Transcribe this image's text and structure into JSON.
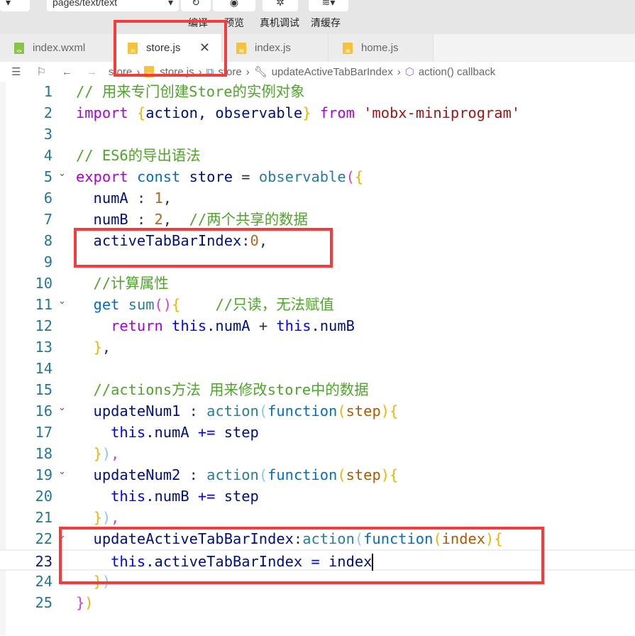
{
  "toolbar": {
    "page_select": "pages/text/text",
    "buttons": [
      {
        "label": "编译",
        "icon": "refresh-icon"
      },
      {
        "label": "预览",
        "icon": "eye-icon"
      },
      {
        "label": "真机调试",
        "icon": "bug-icon"
      },
      {
        "label": "清缓存",
        "icon": "layers-icon"
      }
    ]
  },
  "tabs": [
    {
      "label": "index.wxml",
      "type": "wxml"
    },
    {
      "label": "store.js",
      "type": "js",
      "active": true
    },
    {
      "label": "index.js",
      "type": "js"
    },
    {
      "label": "home.js",
      "type": "js"
    }
  ],
  "breadcrumb": [
    "store",
    "store.js",
    "store",
    "updateActiveTabBarIndex",
    "action() callback"
  ],
  "colors": {
    "highlight": "#f53b3b",
    "line_number": "#237893",
    "comment": "#4fa52a",
    "keyword": "#af00db"
  },
  "current_line": 23,
  "code": [
    {
      "n": "1",
      "t": [
        [
          "// 用来专门创建Store的实例对象",
          "c"
        ]
      ]
    },
    {
      "n": "2",
      "t": [
        [
          "import ",
          "k"
        ],
        [
          "{",
          "y"
        ],
        [
          "action, observable",
          "i"
        ],
        [
          "}",
          "y"
        ],
        [
          " from ",
          "k"
        ],
        [
          "'mobx-miniprogram'",
          "s"
        ]
      ]
    },
    {
      "n": "3",
      "t": []
    },
    {
      "n": "4",
      "t": [
        [
          "// ES6的导出语法",
          "c"
        ]
      ]
    },
    {
      "n": "5",
      "fold": true,
      "t": [
        [
          "export ",
          "k"
        ],
        [
          "const ",
          "fn"
        ],
        [
          "store",
          "i"
        ],
        [
          " = ",
          "p"
        ],
        [
          "observable",
          "f"
        ],
        [
          "(",
          "m"
        ],
        [
          "{",
          "y"
        ]
      ]
    },
    {
      "n": "6",
      "t": [
        [
          "  numA",
          "i"
        ],
        [
          " : ",
          "p"
        ],
        [
          "1",
          "n"
        ],
        [
          ",",
          "p"
        ]
      ]
    },
    {
      "n": "7",
      "t": [
        [
          "  numB",
          "i"
        ],
        [
          " : ",
          "p"
        ],
        [
          "2",
          "n"
        ],
        [
          ",  ",
          "p"
        ],
        [
          "//两个共享的数据",
          "c"
        ]
      ]
    },
    {
      "n": "8",
      "t": [
        [
          "  activeTabBarIndex",
          "i"
        ],
        [
          ":",
          "p"
        ],
        [
          "0",
          "n"
        ],
        [
          ",",
          "p"
        ]
      ]
    },
    {
      "n": "9",
      "t": []
    },
    {
      "n": "10",
      "t": [
        [
          "  //计算属性",
          "c"
        ]
      ]
    },
    {
      "n": "11",
      "fold": true,
      "t": [
        [
          "  get ",
          "fn"
        ],
        [
          "sum",
          "f"
        ],
        [
          "()",
          "m"
        ],
        [
          "{",
          "y"
        ],
        [
          "    //只读，无法赋值",
          "c"
        ]
      ]
    },
    {
      "n": "12",
      "t": [
        [
          "    return ",
          "k"
        ],
        [
          "this",
          "o"
        ],
        [
          ".numA",
          "i"
        ],
        [
          " + ",
          "p"
        ],
        [
          "this",
          "o"
        ],
        [
          ".numB",
          "i"
        ]
      ]
    },
    {
      "n": "13",
      "t": [
        [
          "  ",
          "p"
        ],
        [
          "}",
          "y"
        ],
        [
          ",",
          "p"
        ]
      ]
    },
    {
      "n": "14",
      "t": []
    },
    {
      "n": "15",
      "t": [
        [
          "  //actions方法 用来修改store中的数据",
          "c"
        ]
      ]
    },
    {
      "n": "16",
      "fold": true,
      "t": [
        [
          "  updateNum1",
          "i"
        ],
        [
          " : ",
          "p"
        ],
        [
          "action",
          "f"
        ],
        [
          "(",
          "lb"
        ],
        [
          "function",
          "fn"
        ],
        [
          "(",
          "y"
        ],
        [
          "step",
          "pm"
        ],
        [
          ")",
          "y"
        ],
        [
          "{",
          "y"
        ]
      ]
    },
    {
      "n": "17",
      "t": [
        [
          "    this",
          "o"
        ],
        [
          ".numA ",
          "i"
        ],
        [
          "+=",
          "o"
        ],
        [
          " step",
          "i"
        ]
      ]
    },
    {
      "n": "18",
      "t": [
        [
          "  ",
          "p"
        ],
        [
          "}",
          "y"
        ],
        [
          ")",
          "lb"
        ],
        [
          ",",
          "m"
        ]
      ]
    },
    {
      "n": "19",
      "fold": true,
      "t": [
        [
          "  updateNum2",
          "i"
        ],
        [
          " : ",
          "p"
        ],
        [
          "action",
          "f"
        ],
        [
          "(",
          "lb"
        ],
        [
          "function",
          "fn"
        ],
        [
          "(",
          "y"
        ],
        [
          "step",
          "pm"
        ],
        [
          ")",
          "y"
        ],
        [
          "{",
          "y"
        ]
      ]
    },
    {
      "n": "20",
      "t": [
        [
          "    this",
          "o"
        ],
        [
          ".numB ",
          "i"
        ],
        [
          "+=",
          "o"
        ],
        [
          " step",
          "i"
        ]
      ]
    },
    {
      "n": "21",
      "t": [
        [
          "  ",
          "p"
        ],
        [
          "}",
          "y"
        ],
        [
          ")",
          "lb"
        ],
        [
          ",",
          "m"
        ]
      ]
    },
    {
      "n": "22",
      "fold": true,
      "t": [
        [
          "  updateActiveTabBarIndex",
          "i"
        ],
        [
          ":",
          "p"
        ],
        [
          "action",
          "f"
        ],
        [
          "(",
          "lb"
        ],
        [
          "function",
          "fn"
        ],
        [
          "(",
          "y"
        ],
        [
          "index",
          "pm"
        ],
        [
          ")",
          "y"
        ],
        [
          "{",
          "y"
        ]
      ]
    },
    {
      "n": "23",
      "t": [
        [
          "    this",
          "o"
        ],
        [
          ".activeTabBarIndex ",
          "i"
        ],
        [
          "=",
          "o"
        ],
        [
          " index",
          "i"
        ]
      ]
    },
    {
      "n": "24",
      "t": [
        [
          "  ",
          "p"
        ],
        [
          "}",
          "y"
        ],
        [
          ")",
          "lb"
        ]
      ]
    },
    {
      "n": "25",
      "t": [
        [
          "}",
          "m"
        ],
        [
          ")",
          "y"
        ]
      ]
    }
  ]
}
